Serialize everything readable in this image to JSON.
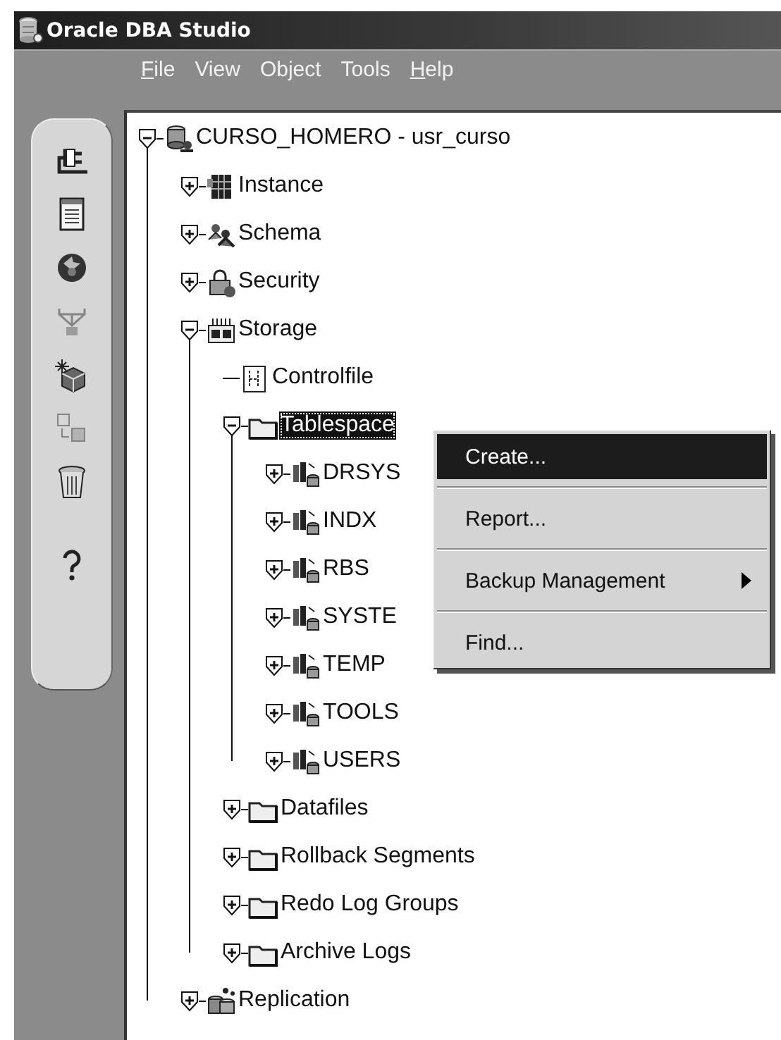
{
  "window": {
    "title": "Oracle DBA Studio"
  },
  "menu_bar": [
    {
      "label": "File",
      "mnemonic": true
    },
    {
      "label": "View",
      "mnemonic": false
    },
    {
      "label": "Object",
      "mnemonic": false
    },
    {
      "label": "Tools",
      "mnemonic": false
    },
    {
      "label": "Help",
      "mnemonic": true
    }
  ],
  "toolbar": [
    {
      "kind": "plug",
      "disabled": false
    },
    {
      "kind": "document",
      "disabled": false
    },
    {
      "kind": "disc",
      "disabled": false
    },
    {
      "kind": "hierarchy",
      "disabled": true
    },
    {
      "kind": "cube",
      "disabled": false
    },
    {
      "kind": "cubes",
      "disabled": true
    },
    {
      "kind": "trash",
      "disabled": false
    },
    {
      "kind": "help",
      "disabled": false
    }
  ],
  "tree": [
    {
      "label": "CURSO_HOMERO - usr_curso",
      "kind": "database",
      "expanded": true,
      "selected": false,
      "children": [
        {
          "label": "Instance",
          "kind": "instance",
          "expanded": false,
          "selected": false
        },
        {
          "label": "Schema",
          "kind": "schema",
          "expanded": false,
          "selected": false
        },
        {
          "label": "Security",
          "kind": "security",
          "expanded": false,
          "selected": false
        },
        {
          "label": "Storage",
          "kind": "storage",
          "expanded": true,
          "selected": false,
          "children": [
            {
              "label": "Controlfile",
              "kind": "file",
              "selected": false
            },
            {
              "label": "Tablespace",
              "kind": "folder",
              "expanded": true,
              "selected": true,
              "children": [
                {
                  "label": "DRSYS",
                  "kind": "tablespace",
                  "expanded": false,
                  "selected": false
                },
                {
                  "label": "INDX",
                  "kind": "tablespace",
                  "expanded": false,
                  "selected": false
                },
                {
                  "label": "RBS",
                  "kind": "tablespace",
                  "expanded": false,
                  "selected": false
                },
                {
                  "label": "SYSTE",
                  "kind": "tablespace",
                  "expanded": false,
                  "selected": false
                },
                {
                  "label": "TEMP",
                  "kind": "tablespace",
                  "expanded": false,
                  "selected": false
                },
                {
                  "label": "TOOLS",
                  "kind": "tablespace",
                  "expanded": false,
                  "selected": false
                },
                {
                  "label": "USERS",
                  "kind": "tablespace",
                  "expanded": false,
                  "selected": false
                }
              ]
            },
            {
              "label": "Datafiles",
              "kind": "folder",
              "expanded": false,
              "selected": false
            },
            {
              "label": "Rollback Segments",
              "kind": "folder",
              "expanded": false,
              "selected": false
            },
            {
              "label": "Redo Log Groups",
              "kind": "folder",
              "expanded": false,
              "selected": false
            },
            {
              "label": "Archive Logs",
              "kind": "folder",
              "expanded": false,
              "selected": false
            }
          ]
        },
        {
          "label": "Replication",
          "kind": "replication",
          "expanded": false,
          "selected": false
        }
      ]
    }
  ],
  "context_menu": [
    {
      "label": "Create...",
      "kind": "item",
      "selected": true
    },
    {
      "label": "Report...",
      "kind": "item",
      "selected": false
    },
    {
      "label": "Backup Management",
      "kind": "submenu",
      "selected": false
    },
    {
      "label": "Find...",
      "kind": "item",
      "selected": false
    }
  ]
}
